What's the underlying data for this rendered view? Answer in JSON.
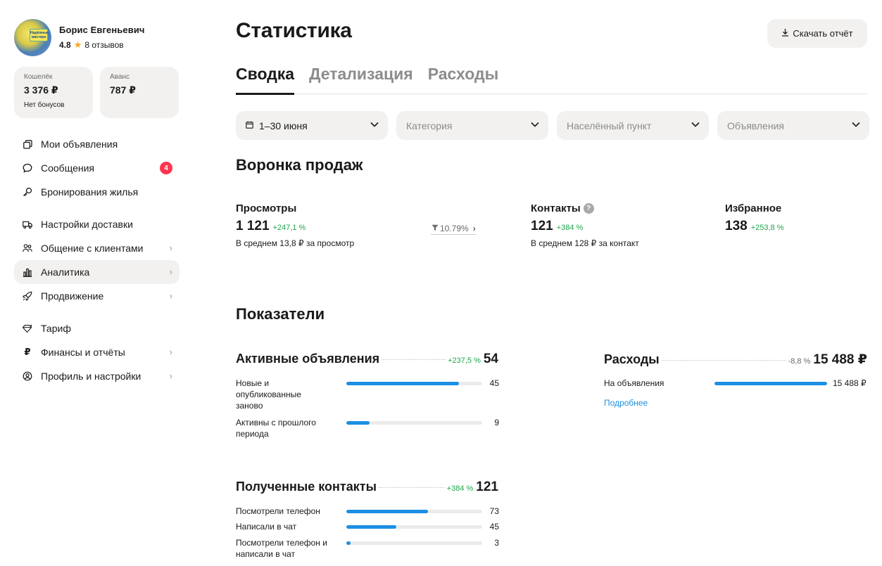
{
  "profile": {
    "name": "Борис Евгеньевич",
    "rating": "4.8",
    "reviews": "8 отзывов",
    "avatar_text": "Надёжные мастера"
  },
  "wallets": [
    {
      "label": "Кошелёк",
      "value": "3 376 ₽",
      "sub": "Нет бонусов"
    },
    {
      "label": "Аванс",
      "value": "787 ₽",
      "sub": ""
    }
  ],
  "nav": {
    "items": [
      {
        "label": "Мои объявления",
        "icon": "listings-icon"
      },
      {
        "label": "Сообщения",
        "icon": "chat-icon",
        "badge": "4"
      },
      {
        "label": "Бронирования жилья",
        "icon": "booking-icon"
      },
      {
        "label": "Настройки доставки",
        "icon": "truck-icon"
      },
      {
        "label": "Общение с клиентами",
        "icon": "users-icon"
      },
      {
        "label": "Аналитика",
        "icon": "chart-icon"
      },
      {
        "label": "Продвижение",
        "icon": "rocket-icon"
      },
      {
        "label": "Тариф",
        "icon": "diamond-icon"
      },
      {
        "label": "Финансы и отчёты",
        "icon": "ruble-icon"
      },
      {
        "label": "Профиль и настройки",
        "icon": "profile-icon"
      }
    ]
  },
  "header": {
    "title": "Статистика",
    "download_label": "Скачать отчёт"
  },
  "tabs": [
    {
      "label": "Сводка",
      "active": true
    },
    {
      "label": "Детализация",
      "active": false
    },
    {
      "label": "Расходы",
      "active": false
    }
  ],
  "filters": {
    "period": "1–30 июня",
    "category": "Категория",
    "city": "Населённый пункт",
    "ads": "Объявления"
  },
  "funnel": {
    "title": "Воронка продаж",
    "views": {
      "label": "Просмотры",
      "value": "1 121",
      "delta": "+247,1 %",
      "sub": "В среднем 13,8 ₽ за просмотр"
    },
    "conversion": "10.79%",
    "contacts": {
      "label": "Контакты",
      "value": "121",
      "delta": "+384 %",
      "sub": "В среднем 128 ₽ за контакт"
    },
    "favorites": {
      "label": "Избранное",
      "value": "138",
      "delta": "+253,8 %"
    }
  },
  "indicators": {
    "title": "Показатели",
    "active_ads": {
      "name": "Активные объявления",
      "delta": "+237,5 %",
      "total": "54",
      "rows": [
        {
          "label": "Новые и опубликованные заново",
          "value": "45",
          "fraction": 0.833
        },
        {
          "label": "Активны с прошлого периода",
          "value": "9",
          "fraction": 0.167
        }
      ]
    },
    "expenses": {
      "name": "Расходы",
      "delta": "-8,8 %",
      "total": "15 488 ₽",
      "rows": [
        {
          "label": "На объявления",
          "value": "15 488 ₽",
          "fraction": 1.0
        }
      ],
      "more": "Подробнее"
    },
    "contacts": {
      "name": "Полученные контакты",
      "delta": "+384 %",
      "total": "121",
      "rows": [
        {
          "label": "Посмотрели телефон",
          "value": "73",
          "fraction": 0.603
        },
        {
          "label": "Написали в чат",
          "value": "45",
          "fraction": 0.372
        },
        {
          "label": "Посмотрели телефон и написали в чат",
          "value": "3",
          "fraction": 0.025
        }
      ]
    }
  }
}
